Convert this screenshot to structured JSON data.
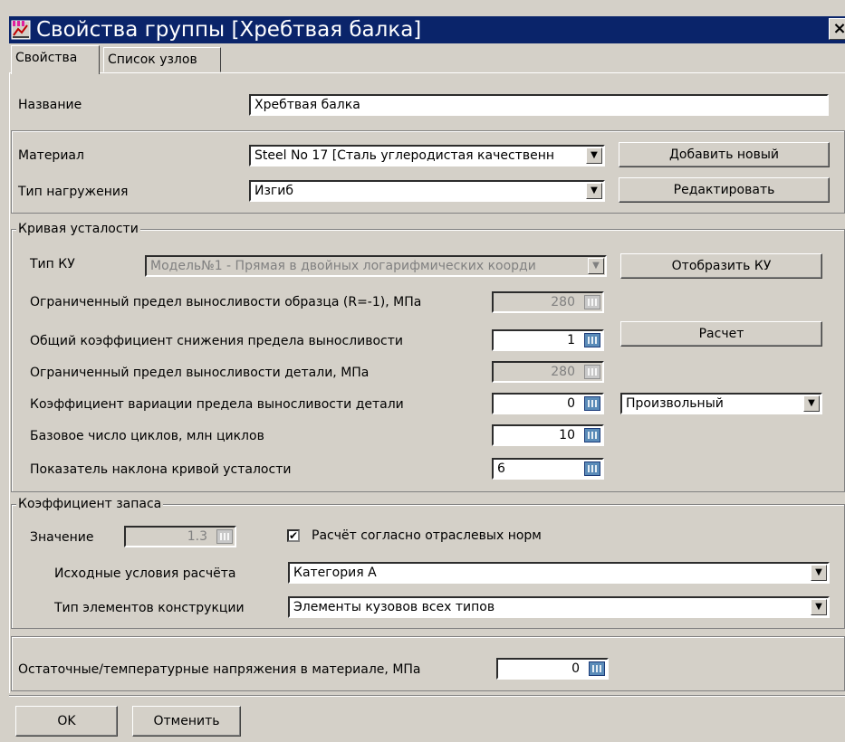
{
  "window": {
    "title": "Свойства группы [Хребтвая балка]",
    "close_glyph": "×"
  },
  "tabs": [
    {
      "label": "Свойства",
      "active": true
    },
    {
      "label": "Список узлов",
      "active": false
    }
  ],
  "name": {
    "label": "Название",
    "value": "Хребтвая балка"
  },
  "material": {
    "label": "Материал",
    "value": "Steel No 17 [Сталь углеродистая качественн",
    "add_button": "Добавить новый"
  },
  "load_type": {
    "label": "Тип нагружения",
    "value": "Изгиб",
    "edit_button": "Редактировать"
  },
  "fatigue": {
    "legend": "Кривая усталости",
    "curve_type_label": "Тип КУ",
    "curve_type_value": "Модель№1 - Прямая в двойных логарифмических коорди",
    "show_button": "Отобразить КУ",
    "calc_button": "Расчет",
    "rows": [
      {
        "label": "Ограниченный предел выносливости образца (R=-1), МПа",
        "value": "280",
        "enabled": false
      },
      {
        "label": "Общий коэффициент снижения предела выносливости",
        "value": "1",
        "enabled": true
      },
      {
        "label": "Ограниченный предел выносливости детали, МПа",
        "value": "280",
        "enabled": false
      },
      {
        "label": "Коэффициент вариации предела выносливости детали",
        "value": "0",
        "enabled": true
      },
      {
        "label": "Базовое число циклов, млн циклов",
        "value": "10",
        "enabled": true
      },
      {
        "label": "Показатель наклона кривой усталости",
        "value": "6",
        "enabled": true
      }
    ],
    "variation_mode": "Произвольный"
  },
  "safety": {
    "legend": "Коэффициент запаса",
    "value_label": "Значение",
    "value": "1.3",
    "norms_checkbox_label": "Расчёт согласно отраслевых норм",
    "norms_checked": true,
    "checkmark": "✔",
    "initial_conditions_label": "Исходные условия расчёта",
    "initial_conditions_value": "Категория А",
    "element_type_label": "Тип элементов конструкции",
    "element_type_value": "Элементы кузовов всех типов"
  },
  "residual": {
    "label": "Остаточные/температурные напряжения в материале, МПа",
    "value": "0"
  },
  "footer": {
    "ok": "OK",
    "cancel": "Отменить"
  },
  "icons": {
    "combo_arrow": "▼"
  },
  "colors": {
    "titlebar": "#0a246a",
    "face": "#d4d0c8",
    "calc_button": "#5a8bb8"
  }
}
